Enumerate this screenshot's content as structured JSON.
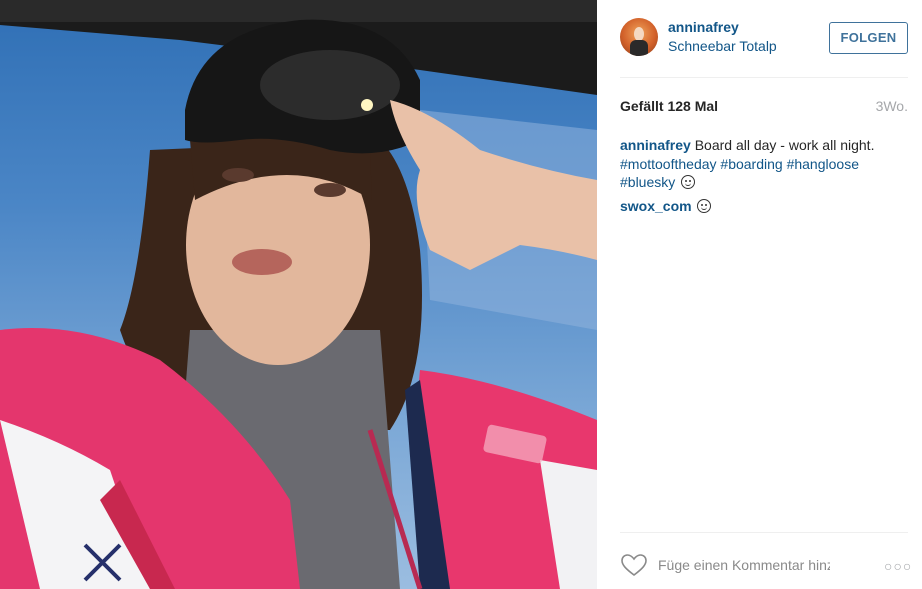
{
  "photo": {
    "icon": "post-photo"
  },
  "header": {
    "username": "anninafrey",
    "location": "Schneebar Totalp",
    "follow_label": "FOLGEN",
    "avatar_icon": "avatar"
  },
  "stats": {
    "likes": "Gefällt 128 Mal",
    "time_ago": "3Wo."
  },
  "caption": {
    "author": "anninafrey",
    "text": "Board all day - work all night.",
    "hashtags": [
      "#mottooftheday",
      "#boarding",
      "#hangloose",
      "#bluesky"
    ]
  },
  "comments": [
    {
      "author": "swox_com",
      "emoji": "smile"
    }
  ],
  "footer": {
    "comment_placeholder": "Füge einen Kommentar hinzu …",
    "like_icon": "heart-icon",
    "more_icon": "more-options-icon",
    "more_glyph": "○○○"
  },
  "colors": {
    "link": "#125688",
    "follow_border": "#3f729b",
    "muted": "#a5a7aa"
  }
}
